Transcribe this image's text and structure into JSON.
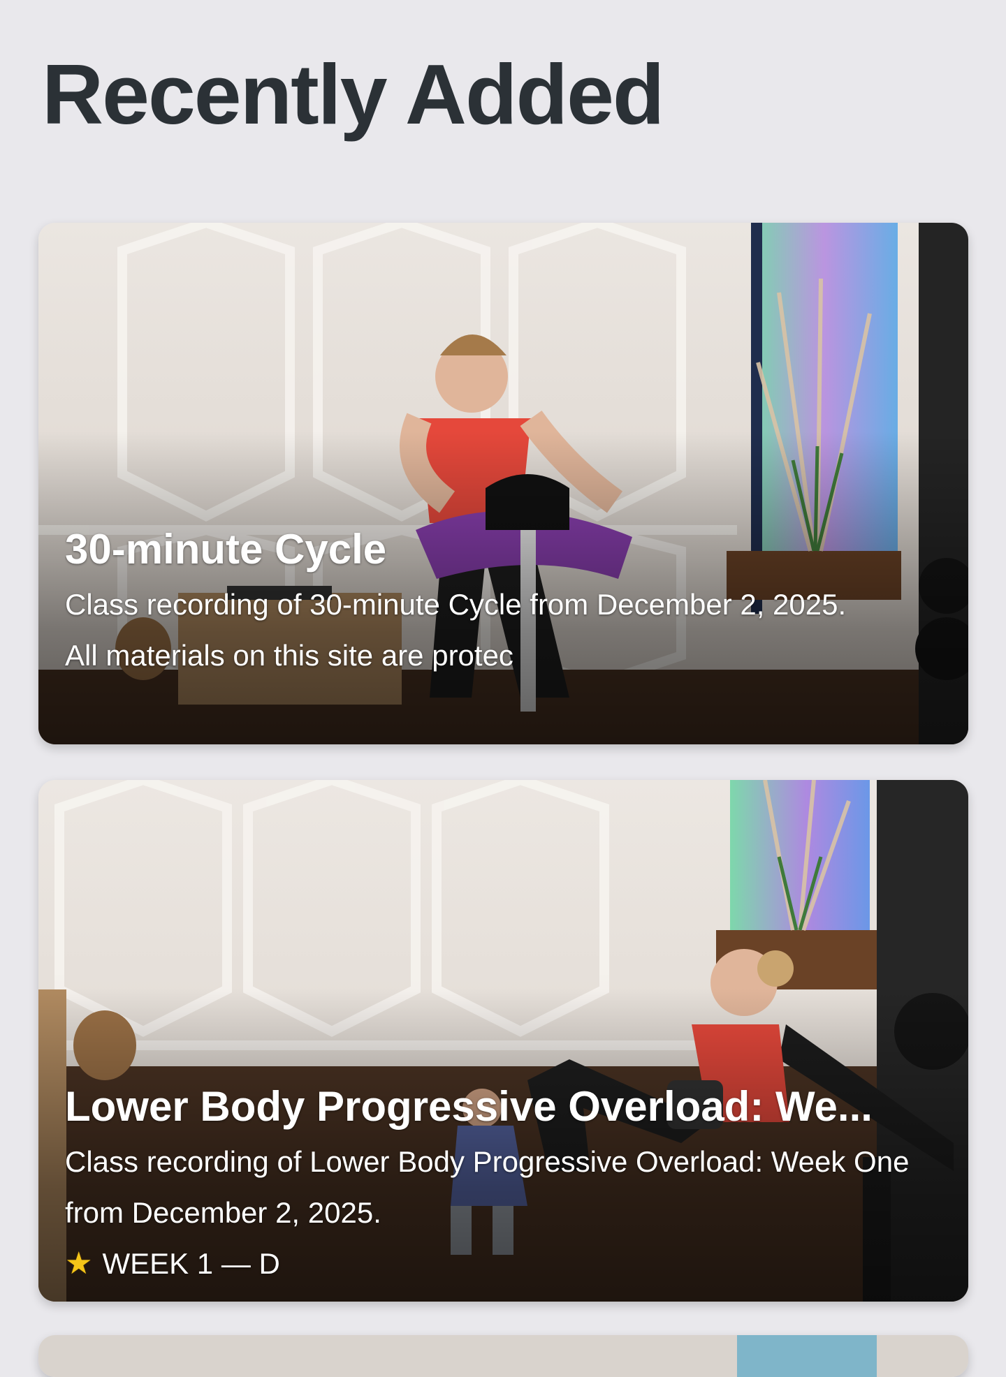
{
  "page": {
    "title": "Recently Added"
  },
  "cards": [
    {
      "title": "30-minute Cycle",
      "description": "Class recording of 30-minute Cycle from December 2, 2025.",
      "extra": "All materials on this site are protec"
    },
    {
      "title": "Lower Body Progressive Overload: We...",
      "description": "Class recording of Lower Body Progressive Overload: Week One from December 2, 2025.",
      "extra": "WEEK 1 — D",
      "extra_icon": "star-icon"
    }
  ],
  "colors": {
    "background": "#e9e8ec",
    "title_text": "#2b3136",
    "card_text": "#ffffff",
    "star": "#f5c518"
  }
}
